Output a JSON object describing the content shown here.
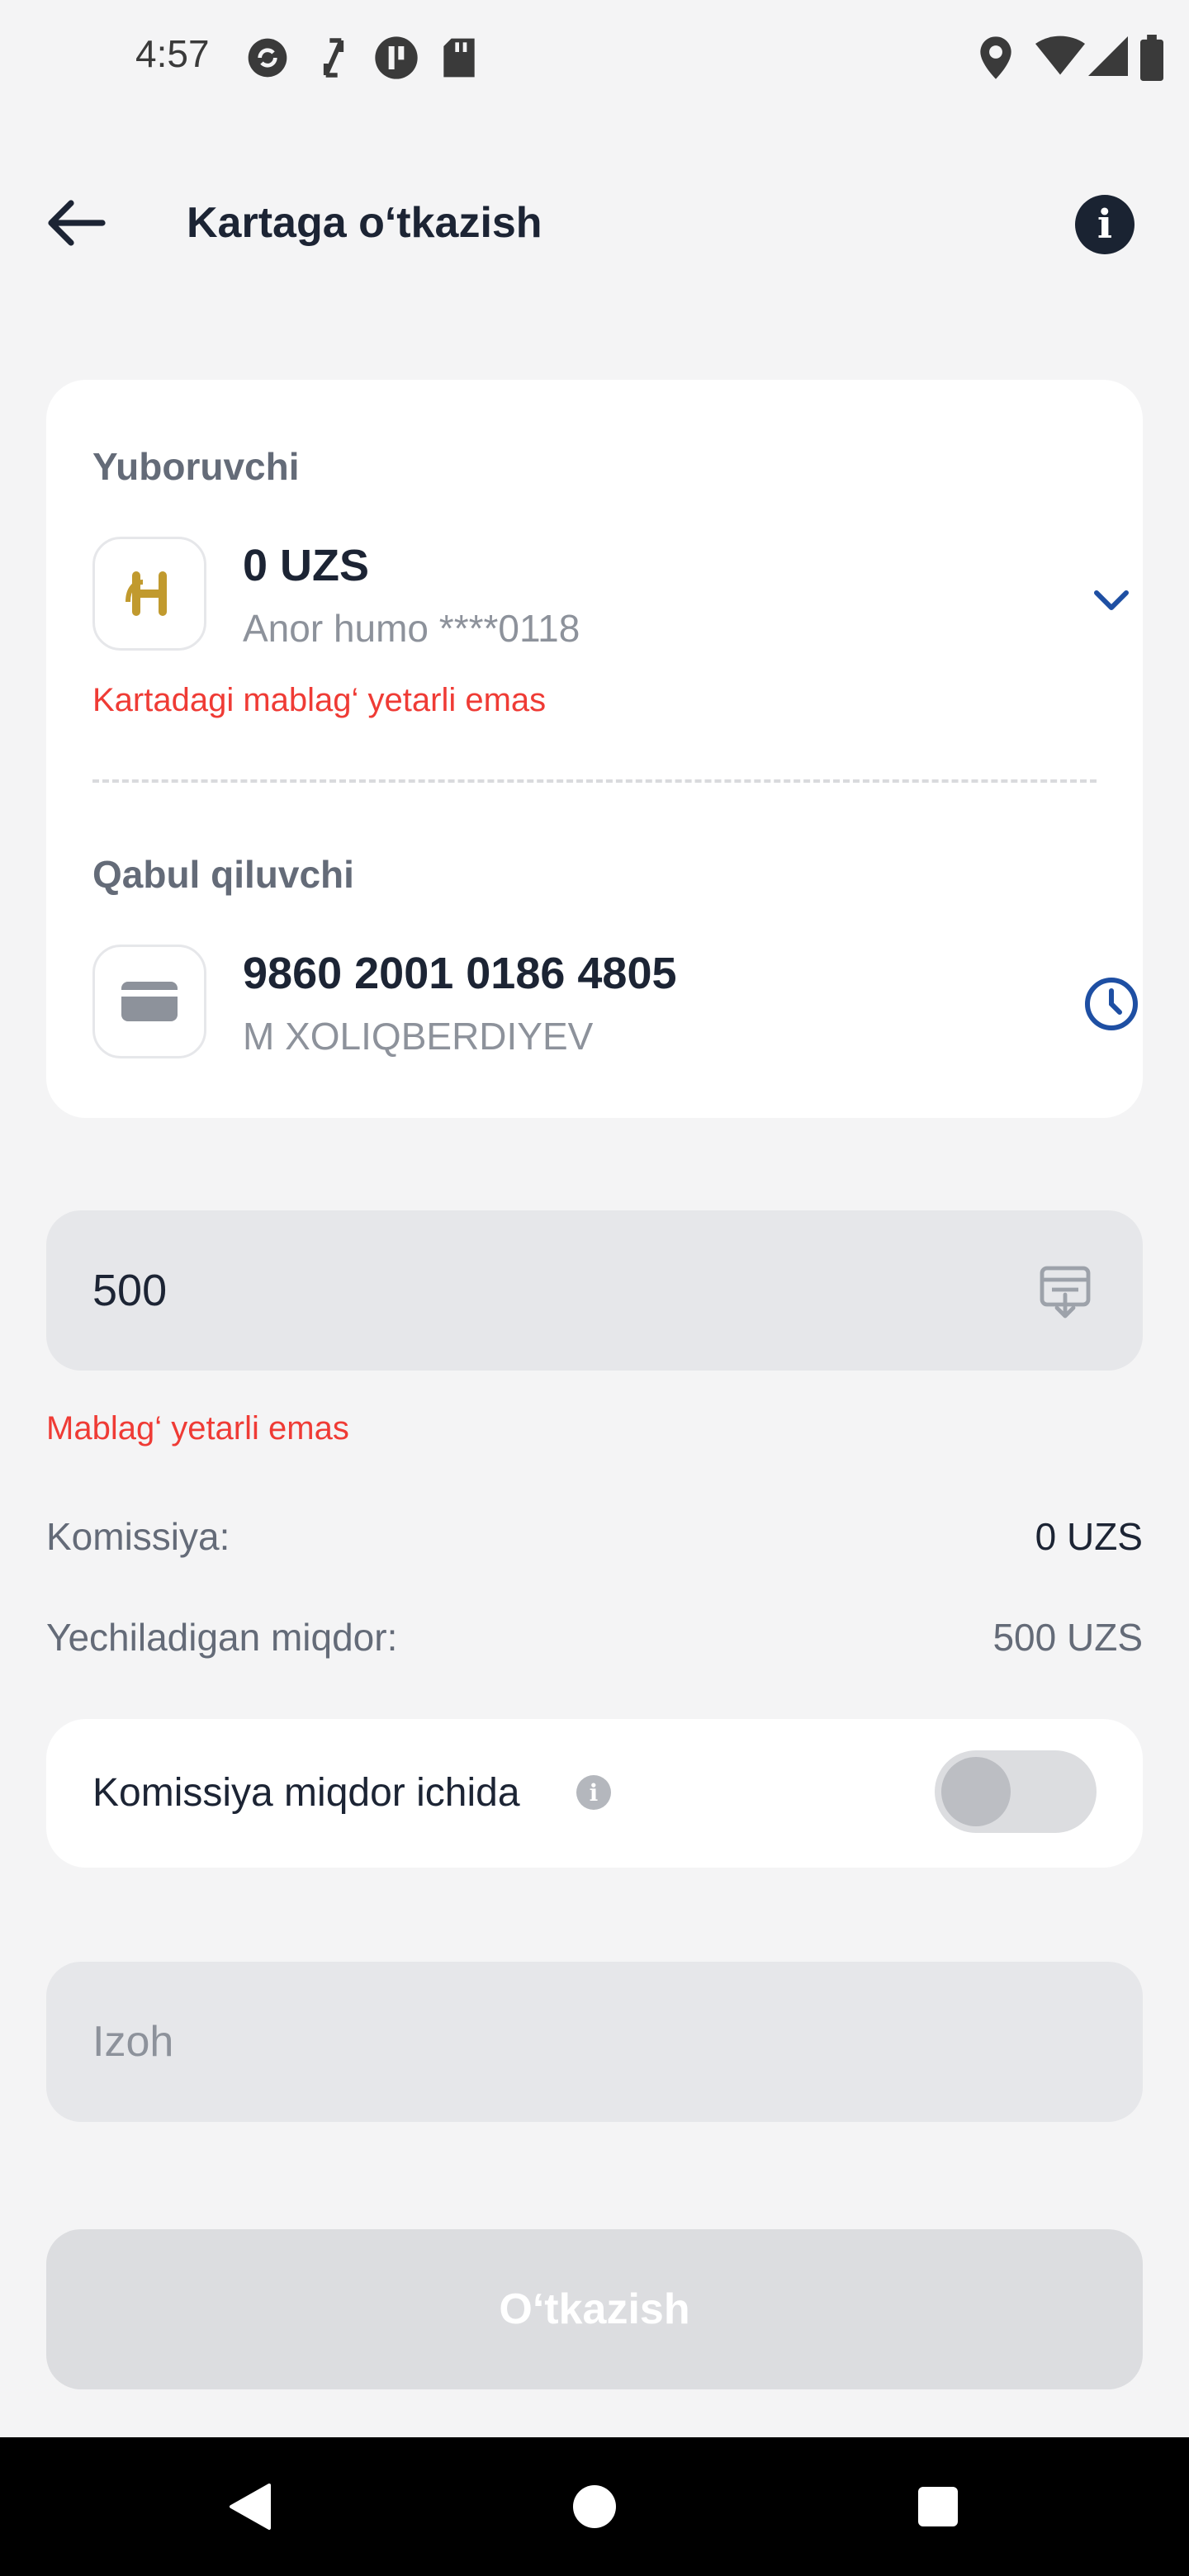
{
  "status_bar": {
    "time": "4:57"
  },
  "header": {
    "title": "Kartaga o‘tkazish"
  },
  "sender": {
    "label": "Yuboruvchi",
    "balance": "0 UZS",
    "card": "Anor humo ****0118",
    "error": "Kartadagi mablag‘ yetarli emas"
  },
  "receiver": {
    "label": "Qabul qiluvchi",
    "card_number": "9860 2001 0186 4805",
    "name": "M XOLIQBERDIYEV"
  },
  "amount": {
    "value": "500",
    "error": "Mablag‘ yetarli emas"
  },
  "commission": {
    "label": "Komissiya:",
    "value": "0 UZS"
  },
  "withdraw": {
    "label": "Yechiladigan miqdor:",
    "value": "500 UZS"
  },
  "commission_toggle": {
    "label": "Komissiya miqdor ichida",
    "enabled": false
  },
  "comment": {
    "placeholder": "Izoh"
  },
  "submit": {
    "label": "O‘tkazish"
  },
  "colors": {
    "accent": "#1e4fa3",
    "error": "#ef3b35",
    "brand_gold": "#c19a2e"
  }
}
